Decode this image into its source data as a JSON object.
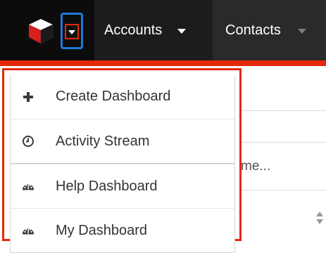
{
  "nav": {
    "tabs": [
      {
        "label": "Accounts"
      },
      {
        "label": "Contacts"
      }
    ]
  },
  "background": {
    "search_fragment": "me..."
  },
  "dropdown": {
    "items": [
      {
        "label": "Create Dashboard",
        "icon": "plus-icon"
      },
      {
        "label": "Activity Stream",
        "icon": "clock-icon"
      },
      {
        "label": "Help Dashboard",
        "icon": "dashboard-gauge-icon"
      },
      {
        "label": "My Dashboard",
        "icon": "dashboard-gauge-icon"
      }
    ]
  },
  "colors": {
    "nav_background": "#0c0c0c",
    "accent_red": "#e5280b",
    "focus_blue": "#1e7bd6",
    "menu_text": "#333333"
  }
}
